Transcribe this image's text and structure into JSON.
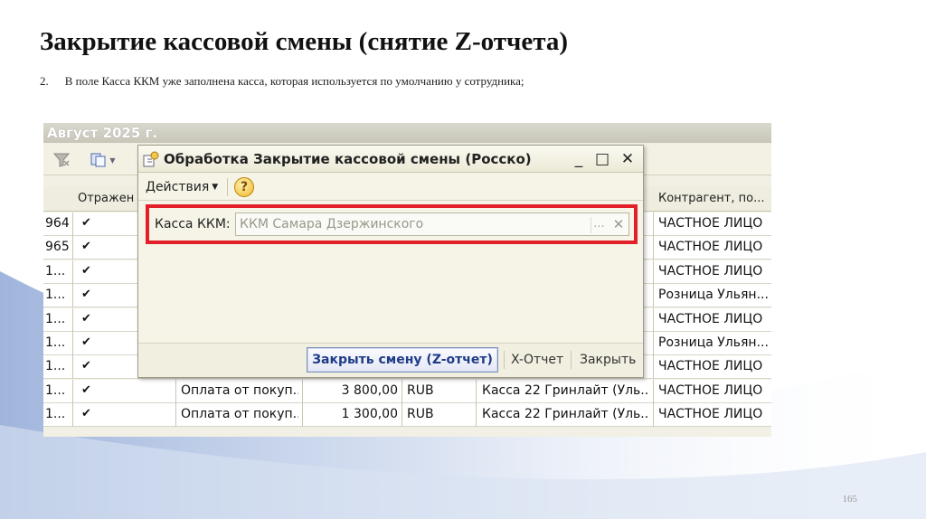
{
  "slide": {
    "title": "Закрытие кассовой смены (снятие Z-отчета)",
    "step_number": "2.",
    "step_text": "В поле Касса ККМ уже заполнена касса, которая используется по умолчанию у сотрудника;",
    "page_number": "165"
  },
  "screenshot": {
    "header_text": "Август 2025 г.",
    "columns": [
      "Отражен",
      "Контрагент, по..."
    ],
    "rows": [
      {
        "num": "964",
        "check": "✔",
        "payment": "",
        "amount": "",
        "currency": "",
        "cashbox": "",
        "counterparty": "ЧАСТНОЕ ЛИЦО"
      },
      {
        "num": "965",
        "check": "✔",
        "payment": "",
        "amount": "",
        "currency": "",
        "cashbox": "",
        "counterparty": "ЧАСТНОЕ ЛИЦО"
      },
      {
        "num": "1...",
        "check": "✔",
        "payment": "",
        "amount": "",
        "currency": "",
        "cashbox": "",
        "counterparty": "ЧАСТНОЕ ЛИЦО"
      },
      {
        "num": "1...",
        "check": "✔",
        "payment": "",
        "amount": "",
        "currency": "",
        "cashbox": "",
        "counterparty": "Розница Ульян..."
      },
      {
        "num": "1...",
        "check": "✔",
        "payment": "",
        "amount": "",
        "currency": "",
        "cashbox": "",
        "counterparty": "ЧАСТНОЕ ЛИЦО"
      },
      {
        "num": "1...",
        "check": "✔",
        "payment": "",
        "amount": "",
        "currency": "",
        "cashbox": "",
        "counterparty": "Розница Ульян..."
      },
      {
        "num": "1...",
        "check": "✔",
        "payment": "",
        "amount": "",
        "currency": "",
        "cashbox": "",
        "counterparty": "ЧАСТНОЕ ЛИЦО"
      },
      {
        "num": "1...",
        "check": "✔",
        "payment": "Оплата от покуп...",
        "amount": "3 800,00",
        "currency": "RUB",
        "cashbox": "Касса 22 Гринлайт (Уль...",
        "counterparty": "ЧАСТНОЕ ЛИЦО"
      },
      {
        "num": "1...",
        "check": "✔",
        "payment": "Оплата от покуп...",
        "amount": "1 300,00",
        "currency": "RUB",
        "cashbox": "Касса 22 Гринлайт (Уль...",
        "counterparty": "ЧАСТНОЕ ЛИЦО"
      }
    ],
    "dialog": {
      "title": "Обработка  Закрытие кассовой смены (Росско)",
      "menu_actions": "Действия",
      "help": "?",
      "kkm_label": "Касса ККМ:",
      "kkm_value": "ККМ Самара Дзержинского",
      "kkm_dots": "...",
      "kkm_clear": "✕",
      "btn_close_shift": "Закрыть смену (Z-отчет)",
      "btn_x_report": "X-Отчет",
      "btn_close": "Закрыть",
      "ctrl_minimize": "_",
      "ctrl_maximize": "□",
      "ctrl_close": "✕"
    },
    "highlight_color": "#e3202a"
  }
}
